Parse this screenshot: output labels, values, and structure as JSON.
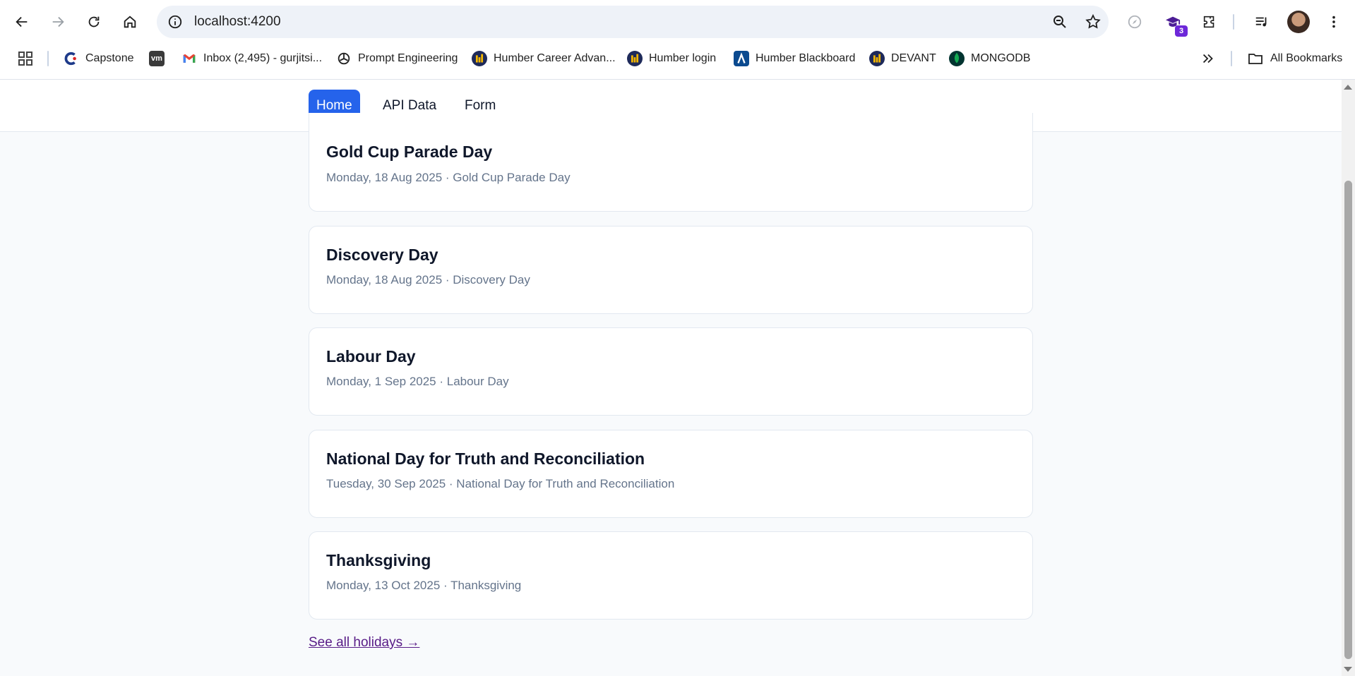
{
  "browser": {
    "url": "localhost:4200",
    "extension_badge": "3",
    "bookmarks": [
      {
        "label": "Capstone",
        "icon": "capstone-icon"
      },
      {
        "label": "",
        "icon": "vm-icon"
      },
      {
        "label": "Inbox (2,495) - gurjitsi...",
        "icon": "gmail-icon"
      },
      {
        "label": "Prompt Engineering",
        "icon": "openai-icon"
      },
      {
        "label": "Humber Career Advan...",
        "icon": "humber-icon"
      },
      {
        "label": "Humber login",
        "icon": "humber-icon"
      },
      {
        "label": "Humber Blackboard",
        "icon": "blackboard-icon"
      },
      {
        "label": "DEVANT",
        "icon": "humber-icon"
      },
      {
        "label": "MONGODB",
        "icon": "mongodb-icon"
      }
    ],
    "vm_icon_text": "vm",
    "all_bookmarks": "All Bookmarks"
  },
  "nav": {
    "items": [
      {
        "label": "Home",
        "active": true
      },
      {
        "label": "API Data",
        "active": false
      },
      {
        "label": "Form",
        "active": false
      }
    ]
  },
  "holidays": [
    {
      "title": "Gold Cup Parade Day",
      "subtitle": "Monday, 18 Aug 2025 · Gold Cup Parade Day"
    },
    {
      "title": "Discovery Day",
      "subtitle": "Monday, 18 Aug 2025 · Discovery Day"
    },
    {
      "title": "Labour Day",
      "subtitle": "Monday, 1 Sep 2025 · Labour Day"
    },
    {
      "title": "National Day for Truth and Reconciliation",
      "subtitle": "Tuesday, 30 Sep 2025 · National Day for Truth and Reconciliation"
    },
    {
      "title": "Thanksgiving",
      "subtitle": "Monday, 13 Oct 2025 · Thanksgiving"
    }
  ],
  "see_all_link": "See all holidays →",
  "colors": {
    "accent": "#2563eb",
    "link_visited": "#581c87",
    "muted_text": "#64748b",
    "page_bg": "#f8fafc"
  }
}
